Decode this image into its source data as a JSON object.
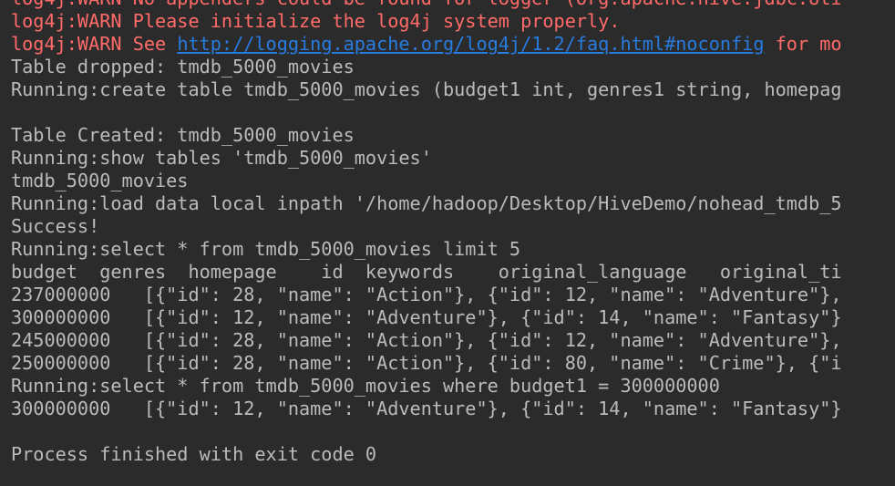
{
  "colors": {
    "background": "#2b2b2b",
    "stdout_text": "#bbbbbb",
    "stderr_text": "#ff6b68",
    "link": "#287bde"
  },
  "console": {
    "warn_1": "log4j:WARN No appenders could be found for logger (org.apache.hive.jdbc.Uti",
    "warn_2": "log4j:WARN Please initialize the log4j system properly.",
    "warn_3_prefix": "log4j:WARN See ",
    "warn_3_link": "http://logging.apache.org/log4j/1.2/faq.html#noconfig",
    "warn_3_suffix": " for mo",
    "lines_a": [
      "Table dropped: tmdb_5000_movies",
      "Running:create table tmdb_5000_movies (budget1 int, genres1 string, homepag",
      "",
      "Table Created: tmdb_5000_movies",
      "Running:show tables 'tmdb_5000_movies'",
      "tmdb_5000_movies",
      "Running:load data local inpath '/home/hadoop/Desktop/HiveDemo/nohead_tmdb_5",
      "Success!",
      "Running:select * from tmdb_5000_movies limit 5",
      "budget  genres  homepage    id  keywords    original_language   original_ti",
      "237000000   [{\"id\": 28, \"name\": \"Action\"}, {\"id\": 12, \"name\": \"Adventure\"},",
      "300000000   [{\"id\": 12, \"name\": \"Adventure\"}, {\"id\": 14, \"name\": \"Fantasy\"}",
      "245000000   [{\"id\": 28, \"name\": \"Action\"}, {\"id\": 12, \"name\": \"Adventure\"},",
      "250000000   [{\"id\": 28, \"name\": \"Action\"}, {\"id\": 80, \"name\": \"Crime\"}, {\"i",
      "Running:select * from tmdb_5000_movies where budget1 = 300000000",
      "300000000   [{\"id\": 12, \"name\": \"Adventure\"}, {\"id\": 14, \"name\": \"Fantasy\"}",
      "",
      "Process finished with exit code 0"
    ]
  }
}
